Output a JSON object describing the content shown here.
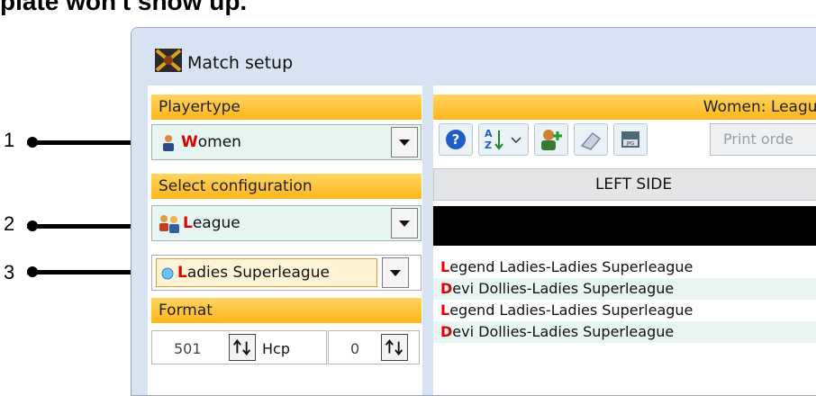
{
  "heading_fragment": "plate won't show up.",
  "callouts": [
    "1",
    "2",
    "3"
  ],
  "window": {
    "title": "Match setup",
    "icon": "dart-board-icon"
  },
  "left_panel": {
    "playertype_label": "Playertype",
    "playertype_value_first": "W",
    "playertype_value_rest": "omen",
    "select_configuration_label": "Select configuration",
    "configuration_value_first": "L",
    "configuration_value_rest": "eague",
    "league_value_first": "L",
    "league_value_rest": "adies Superleague",
    "format_label": "Format",
    "start_score": "501",
    "hcp_label": "Hcp",
    "hcp_value": "0"
  },
  "right_panel": {
    "header": "Women: League",
    "print_order_label": "Print orde",
    "left_side_label": "LEFT SIDE",
    "list_items": [
      {
        "first": "L",
        "rest": "egend Ladies-Ladies Superleague"
      },
      {
        "first": "D",
        "rest": "evi Dollies-Ladies Superleague"
      },
      {
        "first": "L",
        "rest": "egend Ladies-Ladies Superleague"
      },
      {
        "first": "D",
        "rest": "evi Dollies-Ladies Superleague"
      }
    ]
  },
  "colors": {
    "accent_orange": "#ffc22e",
    "combo_bg": "#e6f4f2",
    "first_letter_red": "#e00000"
  }
}
